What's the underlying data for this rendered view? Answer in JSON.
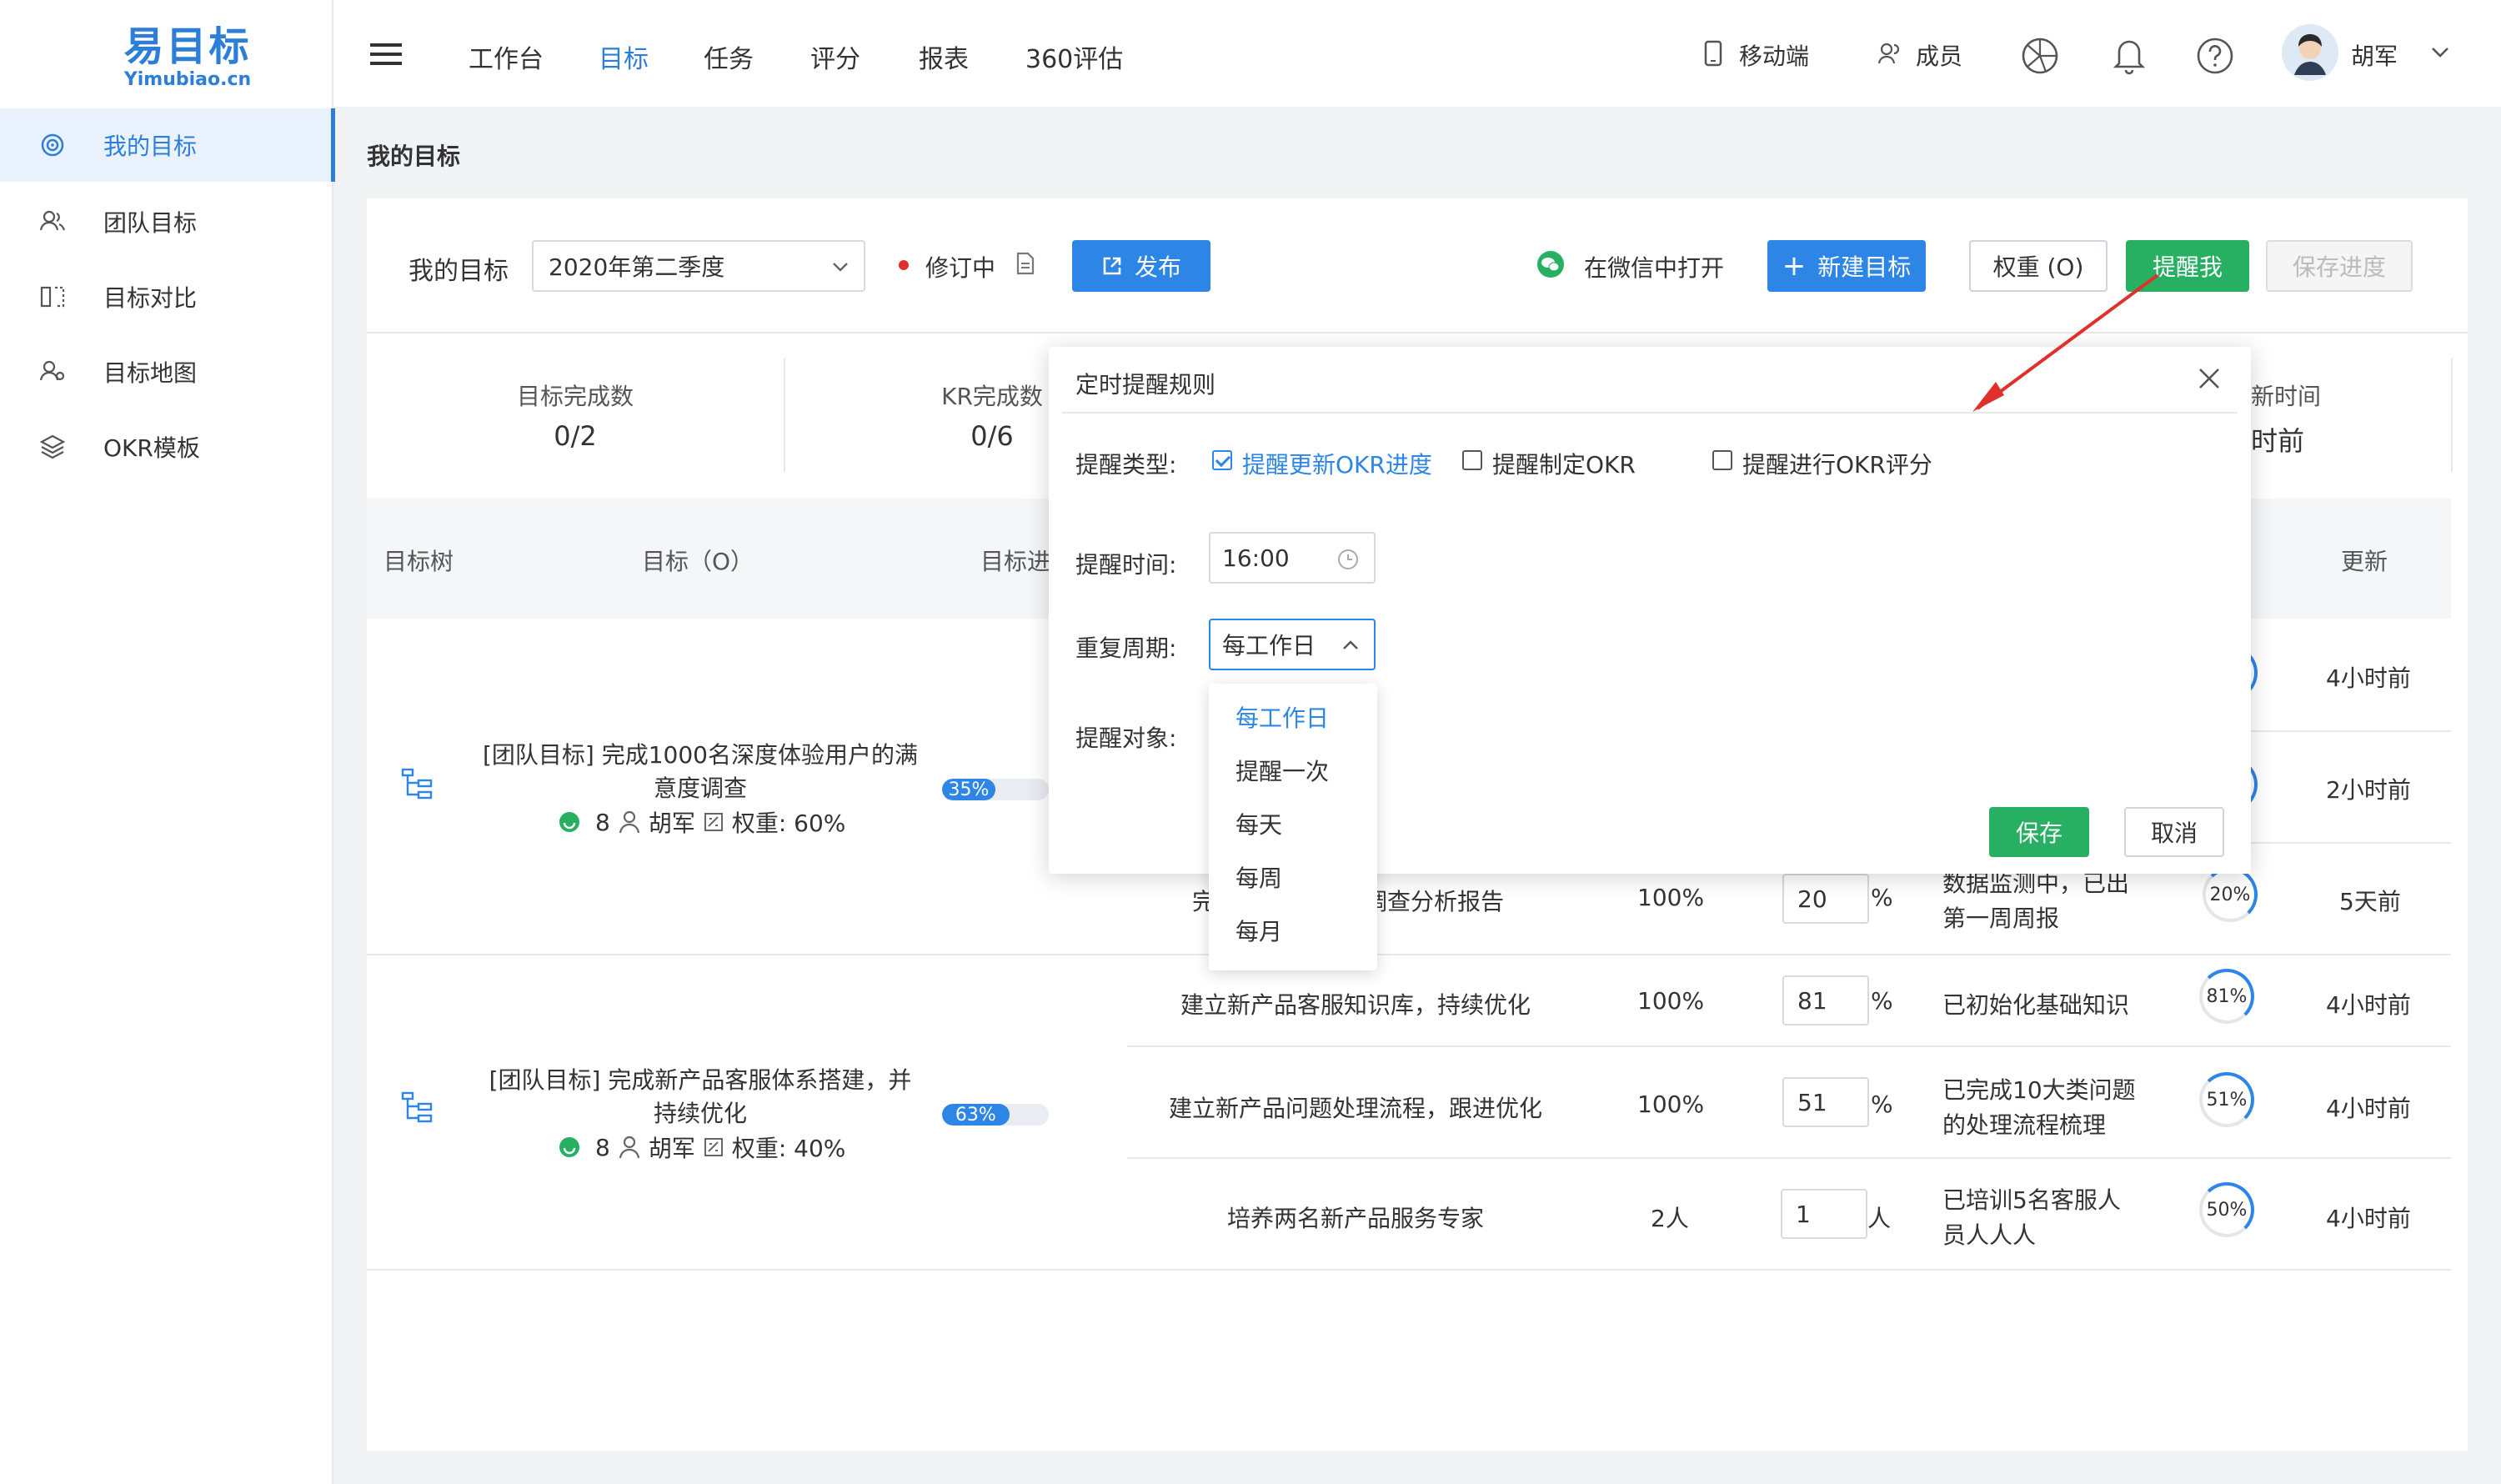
{
  "brand": {
    "name_cn": "易目标",
    "name_en": "Yimubiao.cn",
    "accent": "#2d7ed8",
    "green": "#27b061"
  },
  "sidebar": {
    "items": [
      {
        "label": "我的目标",
        "icon": "target-icon",
        "active": true
      },
      {
        "label": "团队目标",
        "icon": "team-icon"
      },
      {
        "label": "目标对比",
        "icon": "compare-icon"
      },
      {
        "label": "目标地图",
        "icon": "map-icon"
      },
      {
        "label": "OKR模板",
        "icon": "layers-icon"
      }
    ]
  },
  "topnav": {
    "items": [
      "工作台",
      "目标",
      "任务",
      "评分",
      "报表",
      "360评估"
    ],
    "active": "目标",
    "mobile": "移动端",
    "members": "成员",
    "user": "胡军"
  },
  "breadcrumb": "我的目标",
  "toolbar": {
    "label": "我的目标",
    "period": "2020年第二季度",
    "status": "修订中",
    "publish": "发布",
    "wechat": "在微信中打开",
    "new_goal": "新建目标",
    "weight": "权重 (O)",
    "remind": "提醒我",
    "save_progress": "保存进度"
  },
  "stats": [
    {
      "label": "目标完成数",
      "value": "0/2"
    },
    {
      "label": "KR完成数",
      "value": "0/6"
    },
    {
      "label": "新时间",
      "value": "时前"
    }
  ],
  "table": {
    "headers": {
      "tree": "目标树",
      "objective": "目标（O）",
      "progress": "目标进",
      "update": "更新"
    },
    "objectives": [
      {
        "title_line1": "[团队目标] 完成1000名深度体验用户的满",
        "title_line2": "意度调查",
        "count": "8",
        "owner": "胡军",
        "weight": "权重: 60%",
        "progress": "35%",
        "progress_value": 35
      },
      {
        "title_line1": "[团队目标] 完成新产品客服体系搭建，并",
        "title_line2": "持续优化",
        "count": "8",
        "owner": "胡军",
        "weight": "权重: 40%",
        "progress": "63%",
        "progress_value": 63
      }
    ],
    "krs": [
      {
        "name": "",
        "target": "",
        "value": "",
        "unit": "",
        "note1": "",
        "note2": "",
        "ring": "",
        "updated": "4小时前"
      },
      {
        "name": "",
        "target": "",
        "value": "",
        "unit": "",
        "note1": "",
        "note2": "",
        "ring": "",
        "updated": "2小时前"
      },
      {
        "name_l": "完",
        "name_r": "调查分析报告",
        "target": "100%",
        "value": "20",
        "unit": "%",
        "note1": "数据监测中，已出",
        "note2": "第一周周报",
        "ring": "20%",
        "updated": "5天前"
      },
      {
        "name": "建立新产品客服知识库，持续优化",
        "target": "100%",
        "value": "81",
        "unit": "%",
        "note1": "已初始化基础知识",
        "note2": "",
        "ring": "81%",
        "updated": "4小时前"
      },
      {
        "name": "建立新产品问题处理流程，跟进优化",
        "target": "100%",
        "value": "51",
        "unit": "%",
        "note1": "已完成10大类问题",
        "note2": "的处理流程梳理",
        "ring": "51%",
        "updated": "4小时前"
      },
      {
        "name": "培养两名新产品服务专家",
        "target": "2人",
        "value": "1",
        "unit": "人",
        "note1": "已培训5名客服人",
        "note2": "员人人人",
        "ring": "50%",
        "updated": "4小时前"
      }
    ]
  },
  "dialog": {
    "title": "定时提醒规则",
    "type_label": "提醒类型:",
    "types": [
      {
        "label": "提醒更新OKR进度",
        "checked": true
      },
      {
        "label": "提醒制定OKR",
        "checked": false
      },
      {
        "label": "提醒进行OKR评分",
        "checked": false
      }
    ],
    "time_label": "提醒时间:",
    "time_value": "16:00",
    "repeat_label": "重复周期:",
    "repeat_value": "每工作日",
    "target_label": "提醒对象:",
    "save": "保存",
    "cancel": "取消",
    "repeat_options": [
      "每工作日",
      "提醒一次",
      "每天",
      "每周",
      "每月"
    ]
  }
}
